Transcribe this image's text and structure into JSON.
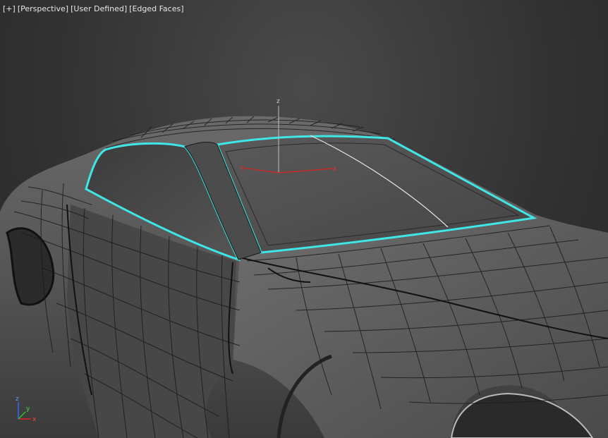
{
  "viewport": {
    "labels": {
      "menu": "[+]",
      "view": "[Perspective]",
      "shading_mode": "[User Defined]",
      "edged_faces": "[Edged Faces]"
    },
    "gizmo": {
      "x_label": "x",
      "y_label": "y",
      "z_label": "z"
    },
    "axis_tripod": {
      "x_label": "x",
      "y_label": "y",
      "z_label": "z"
    }
  },
  "colors": {
    "selection": "#3fe6e6",
    "mesh_fill": "#5a5a5a",
    "glass": "#4f4f4f",
    "wire": "#1b1b1b",
    "axis_x": "#d22",
    "axis_y": "#2c2",
    "axis_z": "#36f"
  }
}
